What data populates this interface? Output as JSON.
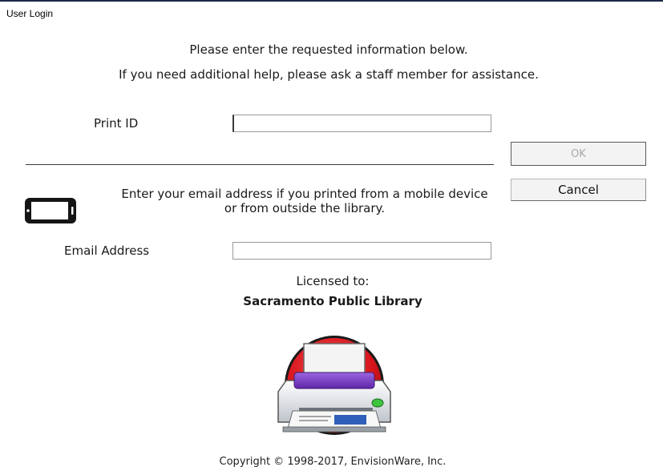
{
  "window": {
    "title": "User Login"
  },
  "instructions": {
    "line1": "Please enter the requested information below.",
    "line2": "If you need additional help, please ask a staff member for assistance."
  },
  "print_id": {
    "label": "Print ID",
    "value": ""
  },
  "buttons": {
    "ok_label": "OK",
    "cancel_label": "Cancel"
  },
  "mobile": {
    "text": "Enter your email address if you printed from a mobile device or from outside the library.",
    "icon": "mobile-device-icon"
  },
  "email": {
    "label": "Email Address",
    "value": ""
  },
  "license": {
    "label": "Licensed to:",
    "licensee": "Sacramento Public Library"
  },
  "logo": {
    "icon": "printer-logo-icon"
  },
  "footer": {
    "copyright": "Copyright © 1998-2017, EnvisionWare, Inc."
  },
  "colors": {
    "title_rule": "#1b2a47",
    "logo_red": "#d8141b",
    "logo_purple": "#7b3fc8",
    "logo_green": "#3ec43e",
    "disabled_text": "#a8a8a8"
  }
}
